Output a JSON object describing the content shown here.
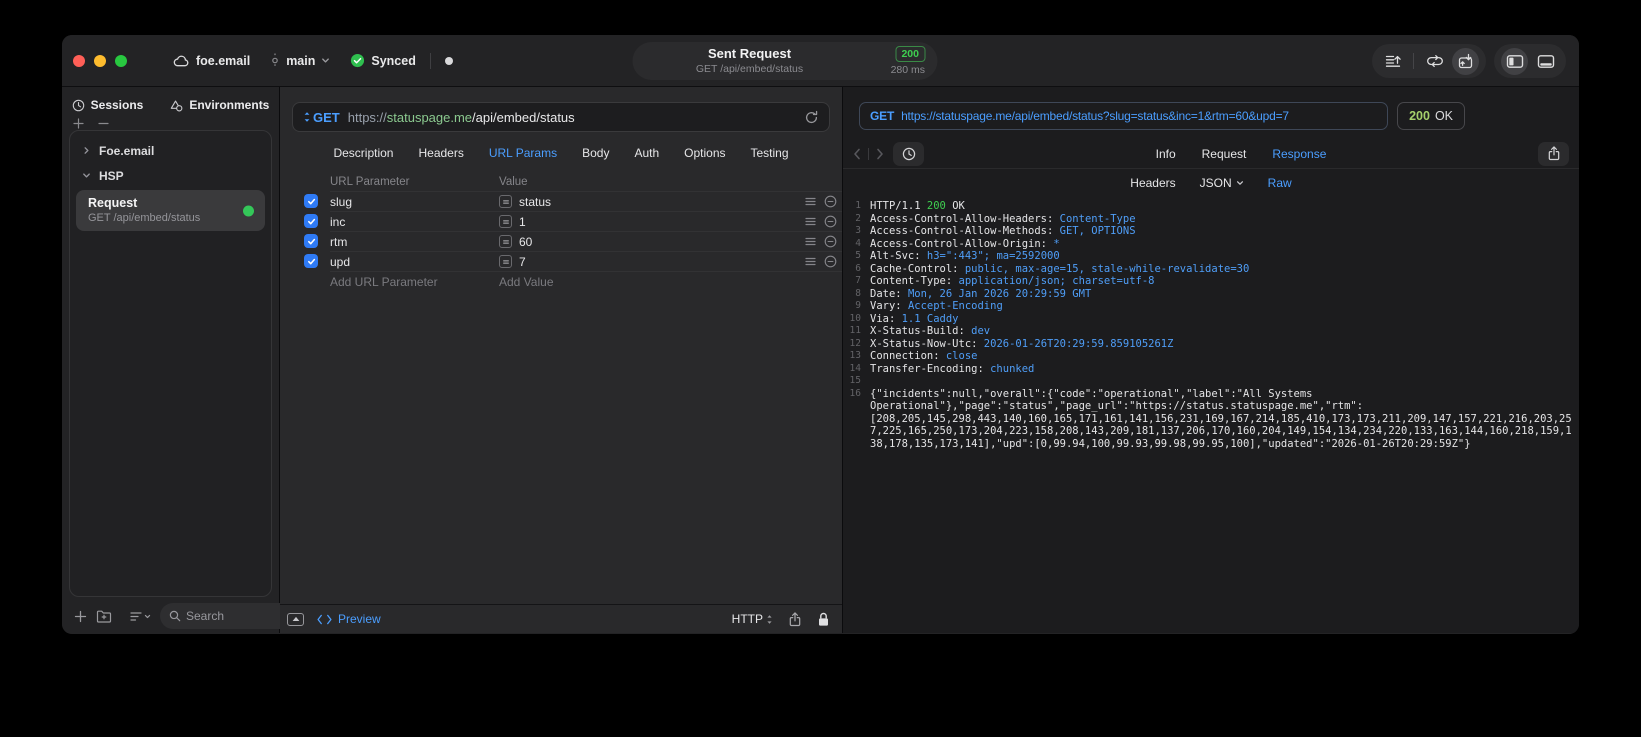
{
  "colors": {
    "accent_blue": "#4b9eff",
    "success_green": "#32d74b",
    "badge_green_text": "#a6d06c",
    "url_host_green": "#8bc98f"
  },
  "titlebar": {
    "project": "foe.email",
    "branch": "main",
    "sync_status": "Synced",
    "summary": {
      "title": "Sent Request",
      "subtitle": "GET /api/embed/status",
      "status_code": "200",
      "duration": "280 ms"
    }
  },
  "sidebar": {
    "tabs": [
      {
        "label": "Sessions"
      },
      {
        "label": "Environments"
      }
    ],
    "groups": [
      {
        "label": "Foe.email",
        "expanded": false
      },
      {
        "label": "HSP",
        "expanded": true
      }
    ],
    "selected_request": {
      "title": "Request",
      "subtitle": "GET /api/embed/status"
    },
    "search_placeholder": "Search"
  },
  "request_editor": {
    "method": "GET",
    "url": {
      "scheme": "https://",
      "host": "statuspage.me",
      "path": "/api/embed/status"
    },
    "tabs": [
      "Description",
      "Headers",
      "URL Params",
      "Body",
      "Auth",
      "Options",
      "Testing"
    ],
    "active_tab": "URL Params",
    "params": {
      "columns": [
        "URL Parameter",
        "Value"
      ],
      "rows": [
        {
          "name": "slug",
          "value": "status",
          "enabled": true
        },
        {
          "name": "inc",
          "value": "1",
          "enabled": true
        },
        {
          "name": "rtm",
          "value": "60",
          "enabled": true
        },
        {
          "name": "upd",
          "value": "7",
          "enabled": true
        }
      ],
      "add_name_placeholder": "Add URL Parameter",
      "add_value_placeholder": "Add Value"
    },
    "footer": {
      "preview_label": "Preview",
      "protocol": "HTTP"
    }
  },
  "response_viewer": {
    "method": "GET",
    "url": "https://statuspage.me/api/embed/status?slug=status&inc=1&rtm=60&upd=7",
    "status_code": "200",
    "status_text": "OK",
    "tabs": [
      "Info",
      "Request",
      "Response"
    ],
    "active_tab": "Response",
    "subtabs": [
      {
        "label": "Headers",
        "dropdown": false
      },
      {
        "label": "JSON",
        "dropdown": true
      },
      {
        "label": "Raw",
        "dropdown": false
      }
    ],
    "active_subtab": "Raw",
    "status_line": {
      "line": 1,
      "protocol": "HTTP/1.1 ",
      "code": "200",
      "text": " OK"
    },
    "headers": [
      {
        "line": 2,
        "key": "Access-Control-Allow-Headers",
        "value": "Content-Type"
      },
      {
        "line": 3,
        "key": "Access-Control-Allow-Methods",
        "value": "GET, OPTIONS"
      },
      {
        "line": 4,
        "key": "Access-Control-Allow-Origin",
        "value": "*"
      },
      {
        "line": 5,
        "key": "Alt-Svc",
        "value": "h3=\":443\"; ma=2592000"
      },
      {
        "line": 6,
        "key": "Cache-Control",
        "value": "public, max-age=15, stale-while-revalidate=30"
      },
      {
        "line": 7,
        "key": "Content-Type",
        "value": "application/json; charset=utf-8"
      },
      {
        "line": 8,
        "key": "Date",
        "value": "Mon, 26 Jan 2026 20:29:59 GMT"
      },
      {
        "line": 9,
        "key": "Vary",
        "value": "Accept-Encoding"
      },
      {
        "line": 10,
        "key": "Via",
        "value": "1.1 Caddy"
      },
      {
        "line": 11,
        "key": "X-Status-Build",
        "value": "dev"
      },
      {
        "line": 12,
        "key": "X-Status-Now-Utc",
        "value": "2026-01-26T20:29:59.859105261Z"
      },
      {
        "line": 13,
        "key": "Connection",
        "value": "close"
      },
      {
        "line": 14,
        "key": "Transfer-Encoding",
        "value": "chunked"
      }
    ],
    "blank_line": 15,
    "body_line": 16,
    "body": "{\"incidents\":null,\"overall\":{\"code\":\"operational\",\"label\":\"All Systems Operational\"},\"page\":\"status\",\"page_url\":\"https://status.statuspage.me\",\"rtm\":[208,205,145,298,443,140,160,165,171,161,141,156,231,169,167,214,185,410,173,173,211,209,147,157,221,216,203,257,225,165,250,173,204,223,158,208,143,209,181,137,206,170,160,204,149,154,134,234,220,133,163,144,160,218,159,138,178,135,173,141],\"upd\":[0,99.94,100,99.93,99.98,99.95,100],\"updated\":\"2026-01-26T20:29:59Z\"}"
  }
}
